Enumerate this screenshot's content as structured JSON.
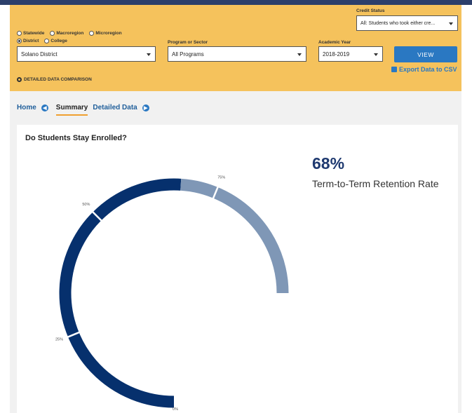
{
  "filters": {
    "geo_options": [
      {
        "label": "Statewide",
        "checked": false
      },
      {
        "label": "Macroregion",
        "checked": false
      },
      {
        "label": "Microregion",
        "checked": false
      },
      {
        "label": "District",
        "checked": true
      },
      {
        "label": "College",
        "checked": false
      }
    ],
    "district_value": "Solano District",
    "program_label": "Program or Sector",
    "program_value": "All Programs",
    "year_label": "Academic Year",
    "year_value": "2018-2019",
    "credit_label": "Credit Status",
    "credit_value": "All: Students who took either cre...",
    "view_button": "VIEW",
    "export_link": "Export Data to CSV",
    "detailed_comparison": "DETAILED DATA COMPARISON"
  },
  "nav": {
    "home": "Home",
    "summary": "Summary",
    "detailed_data": "Detailed Data"
  },
  "card": {
    "title": "Do Students Stay Enrolled?",
    "big_value": "68%",
    "metric_label": "Term-to-Term Retention Rate"
  },
  "chart_data": {
    "type": "gauge",
    "value": 68,
    "max": 100,
    "tick_labels": [
      "0%",
      "25%",
      "50%",
      "75%"
    ],
    "colors": {
      "filled": "#06306d",
      "remaining": "#7f97b6"
    }
  }
}
